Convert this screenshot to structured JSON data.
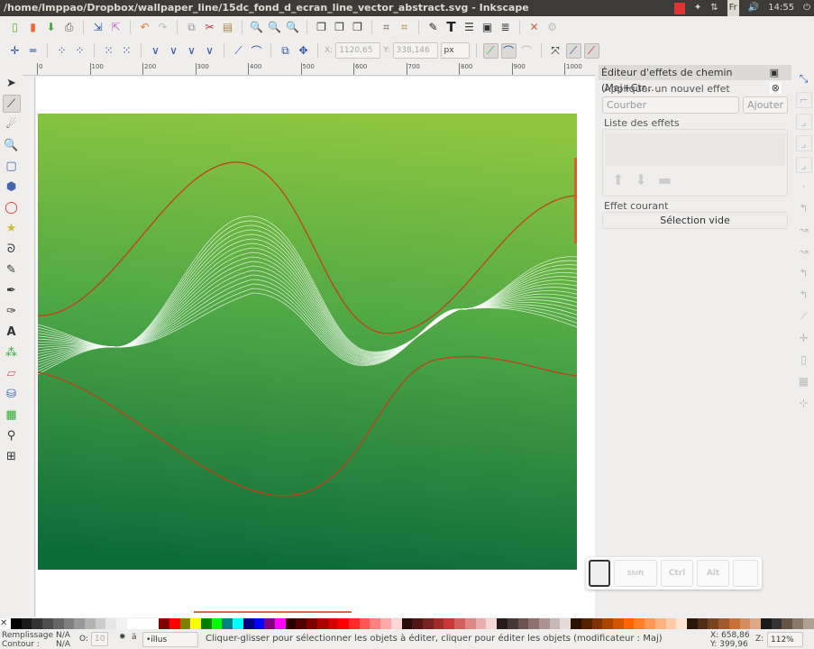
{
  "window": {
    "title": "/home/lmppao/Dropbox/wallpaper_line/15dc_fond_d_ecran_line_vector_abstract.svg - Inkscape",
    "keyboard_layout": "Fr",
    "time": "14:55"
  },
  "node_toolbar": {
    "x_label": "X:",
    "x_value": "1120,65",
    "y_label": "Y:",
    "y_value": "338,146",
    "unit": "px"
  },
  "ruler": {
    "ticks": [
      "0",
      "100",
      "200",
      "300",
      "400",
      "500",
      "600",
      "700",
      "800",
      "900",
      "1000"
    ]
  },
  "panel": {
    "title": "Éditeur d'effets de chemin (Maj+Ctr...",
    "apply_label": "Appliquer un nouvel effet",
    "effect_select": "Courber",
    "add_button": "Ajouter",
    "list_label": "Liste des effets",
    "current_label": "Effet courant",
    "current_value": "Sélection vide"
  },
  "keys": {
    "shift": "Shift",
    "ctrl": "Ctrl",
    "alt": "Alt"
  },
  "palette": [
    "#000000",
    "#1a1a1a",
    "#333333",
    "#4d4d4d",
    "#666666",
    "#808080",
    "#999999",
    "#b3b3b3",
    "#cccccc",
    "#e6e6e6",
    "#f2f2f2",
    "#ffffff",
    "#ffffff",
    "#ffffff",
    "#800000",
    "#ff0000",
    "#808000",
    "#ffff00",
    "#008000",
    "#00ff00",
    "#008080",
    "#00ffff",
    "#000080",
    "#0000ff",
    "#800080",
    "#ff00ff",
    "#2b0000",
    "#550000",
    "#800000",
    "#aa0000",
    "#d40000",
    "#ff0000",
    "#ff2a2a",
    "#ff5555",
    "#ff8080",
    "#ffaaaa",
    "#ffd5d5",
    "#280b0b",
    "#501616",
    "#782121",
    "#a02c2c",
    "#c83737",
    "#d35f5f",
    "#de8787",
    "#e9afaf",
    "#f4d7d7",
    "#241c1c",
    "#483737",
    "#6c5353",
    "#916f6f",
    "#ac9393",
    "#c8b7b7",
    "#e3dbdb",
    "#2b1100",
    "#552200",
    "#803300",
    "#aa4400",
    "#d45500",
    "#ff6600",
    "#ff7f2a",
    "#ff9955",
    "#ffb380",
    "#ffccaa",
    "#ffe6d5",
    "#28170b",
    "#502d16",
    "#784421",
    "#a05a2c",
    "#c87137",
    "#d38d5f",
    "#dea887",
    "#1a1a1a",
    "#333333",
    "#665544",
    "#8a7a6a",
    "#b0a090"
  ],
  "status": {
    "fill_label": "Remplissage :",
    "fill_value": "N/A",
    "stroke_label": "Contour :",
    "stroke_value": "N/A",
    "opacity_label": "O:",
    "opacity_value": "10",
    "layer": "•illus",
    "message": "Cliquer-glisser pour sélectionner les objets à éditer, cliquer pour éditer les objets (modificateur : Maj)",
    "x_label": "X:",
    "x_value": "658,86",
    "y_label": "Y:",
    "y_value": "399,96",
    "zoom_label": "Z:",
    "zoom_value": "112%"
  },
  "colors": {
    "bg_top": "#8dc63f",
    "bg_bottom": "#0d6b3a",
    "red_path": "#c1401a"
  }
}
